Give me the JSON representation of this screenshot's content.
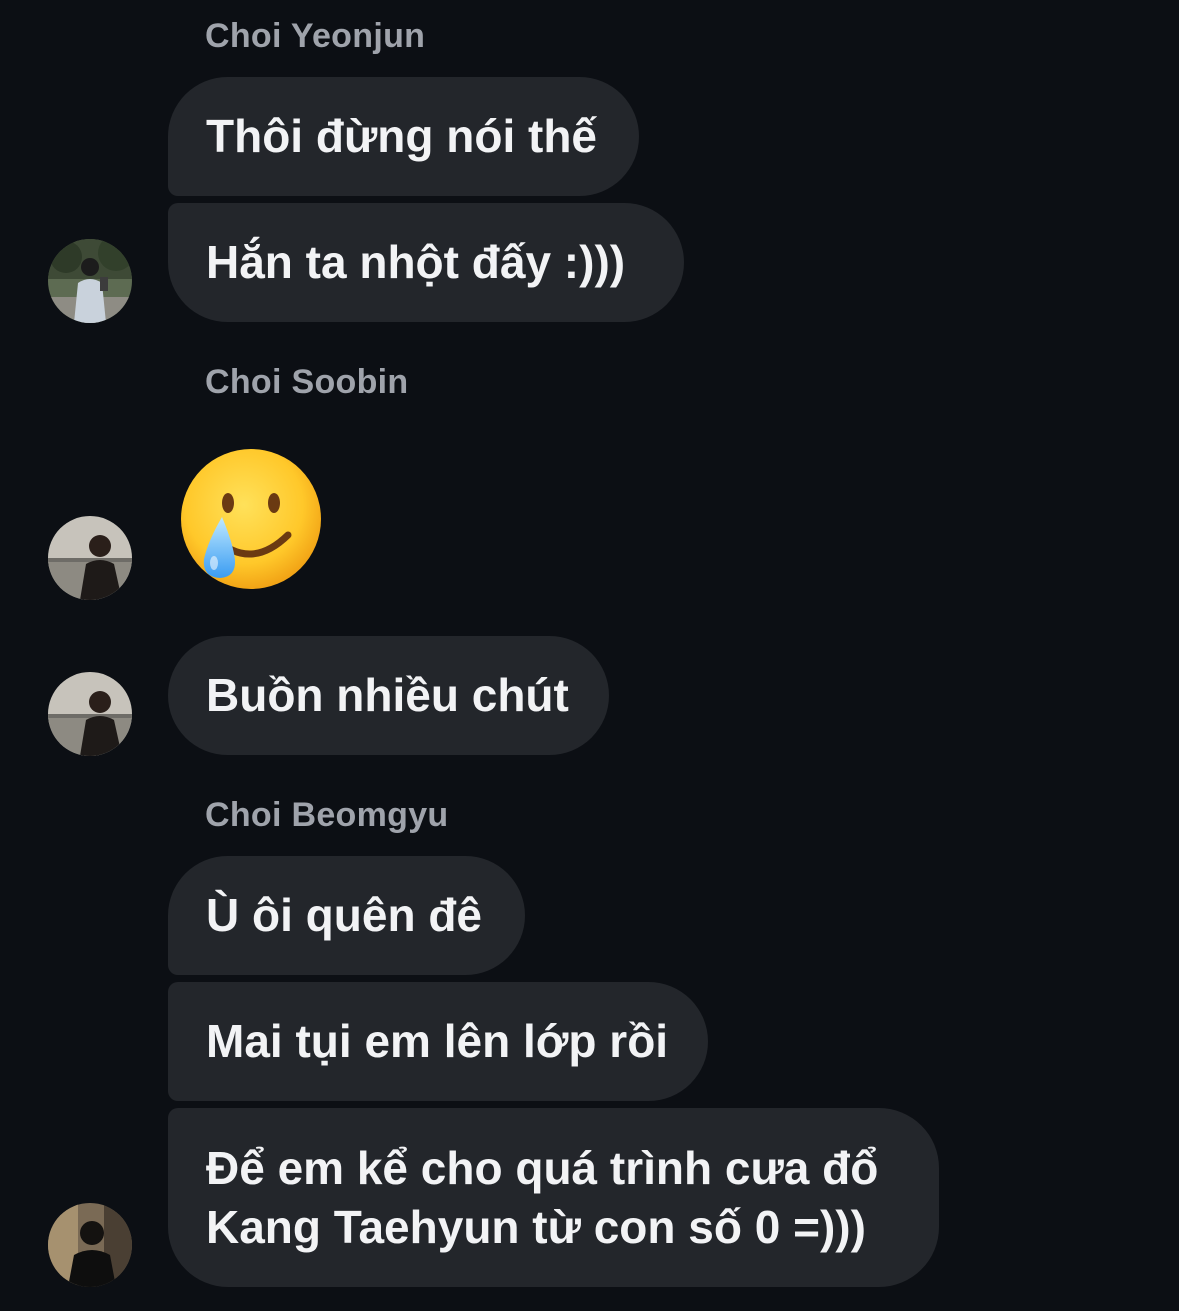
{
  "messages": {
    "group1": {
      "sender": "Choi Yeonjun",
      "m1": "Thôi đừng nói thế",
      "m2": "Hắn ta nhột đấy :)))"
    },
    "group2": {
      "sender": "Choi Soobin",
      "emoji": "smiling-face-with-tear",
      "m1": "Buồn nhiều chút"
    },
    "group3": {
      "sender": "Choi Beomgyu",
      "m1": "Ù ôi quên đê",
      "m2": "Mai tụi em lên lớp rồi",
      "m3_line1": "Để em kể cho quá trình cưa đổ",
      "m3_line2": "Kang Taehyun từ con số 0 =)))"
    }
  },
  "colors": {
    "background": "#0c0f14",
    "bubble": "#23262b",
    "sender_name": "#9fa3ab",
    "message_text": "#f2f3f5"
  }
}
